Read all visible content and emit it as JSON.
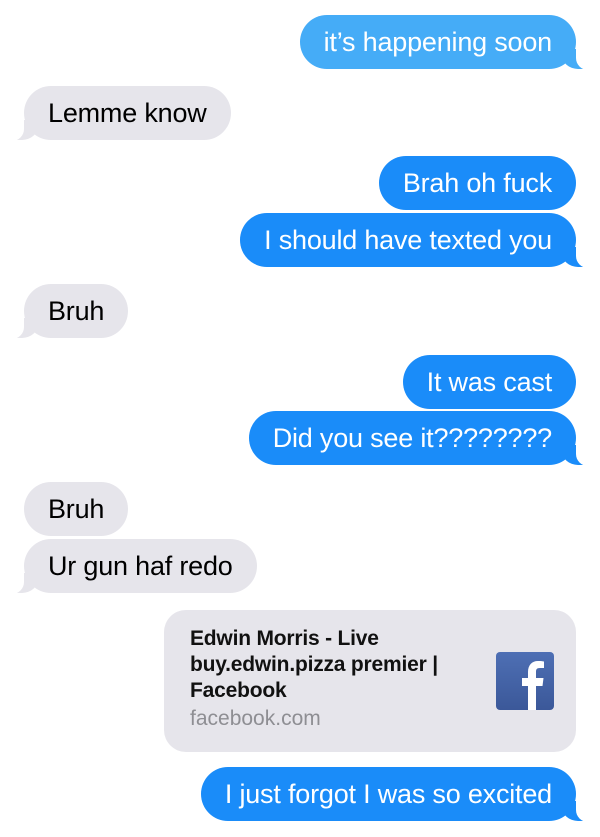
{
  "conversation": {
    "messages": [
      {
        "from": "me",
        "text": "it’s happening soon"
      },
      {
        "from": "them",
        "text": "Lemme know"
      },
      {
        "from": "me",
        "text": "Brah oh fuck"
      },
      {
        "from": "me",
        "text": "I should have texted you"
      },
      {
        "from": "them",
        "text": "Bruh"
      },
      {
        "from": "me",
        "text": "It was cast"
      },
      {
        "from": "me",
        "text": "Did you see it????????"
      },
      {
        "from": "them",
        "text": "Bruh"
      },
      {
        "from": "them",
        "text": "Ur gun haf redo"
      },
      {
        "from": "me",
        "text": "I just forgot I was so excited"
      }
    ],
    "link_preview": {
      "title": "Edwin Morris - Live buy.edwin.pizza premier | Facebook",
      "domain": "facebook.com",
      "icon": "facebook-icon"
    }
  },
  "colors": {
    "outgoing_bubble": "#1a8cf9",
    "incoming_bubble": "#e6e5eb",
    "facebook_blue": "#3b5998"
  }
}
